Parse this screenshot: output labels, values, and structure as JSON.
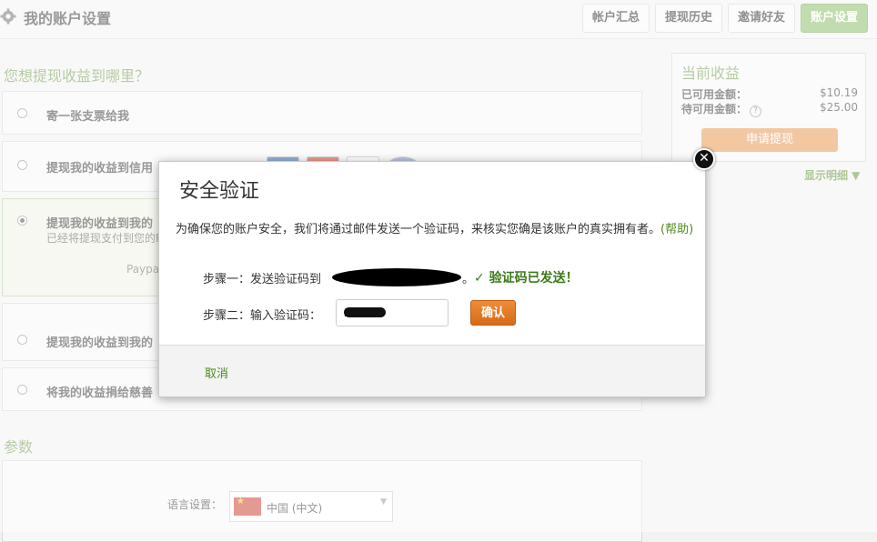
{
  "header": {
    "title": "我的账户设置",
    "tabs": [
      {
        "label": "帐户汇总",
        "active": false
      },
      {
        "label": "提现历史",
        "active": false
      },
      {
        "label": "邀请好友",
        "active": false
      },
      {
        "label": "账户设置",
        "active": true
      }
    ]
  },
  "withdraw": {
    "section_title": "您想提现收益到哪里？",
    "options": [
      {
        "label": "寄一张支票给我",
        "selected": false
      },
      {
        "label": "提现我的收益到信用",
        "selected": false
      },
      {
        "label": "提现我的收益到我的",
        "sub": "已经将提现支付到您的P",
        "extra": "Paypal",
        "selected": true
      },
      {
        "label": "提现我的收益到我的",
        "selected": false
      },
      {
        "label": "将我的收益捐给慈善",
        "selected": false
      }
    ]
  },
  "earnings": {
    "title": "当前收益",
    "available_label": "已可用金额：",
    "available_value": "$10.19",
    "pending_label": "待可用金额：",
    "pending_value": "$25.00",
    "help_icon": "?",
    "withdraw_button": "申请提现",
    "details_link": "显示明细 ▼"
  },
  "params": {
    "title": "参数",
    "language_label": "语言设置：",
    "language_value": "中国 (中文)"
  },
  "modal": {
    "title": "安全验证",
    "description": "为确保您的账户安全，我们将通过邮件发送一个验证码，来核实您确是该账户的真实拥有者。",
    "help_link": "(帮助)",
    "step1_label": "步骤一：发送验证码到",
    "step1_suffix": "。",
    "sent_message": "✓ 验证码已发送！",
    "step2_label": "步骤二：输入验证码：",
    "code_value": "2",
    "confirm_button": "确认",
    "cancel_link": "取消",
    "close_icon": "✕"
  },
  "colors": {
    "accent_green": "#7aa35a",
    "active_tab": "#8fbf6c",
    "confirm_orange": "#e67e22",
    "link_green": "#4d8a1f"
  }
}
